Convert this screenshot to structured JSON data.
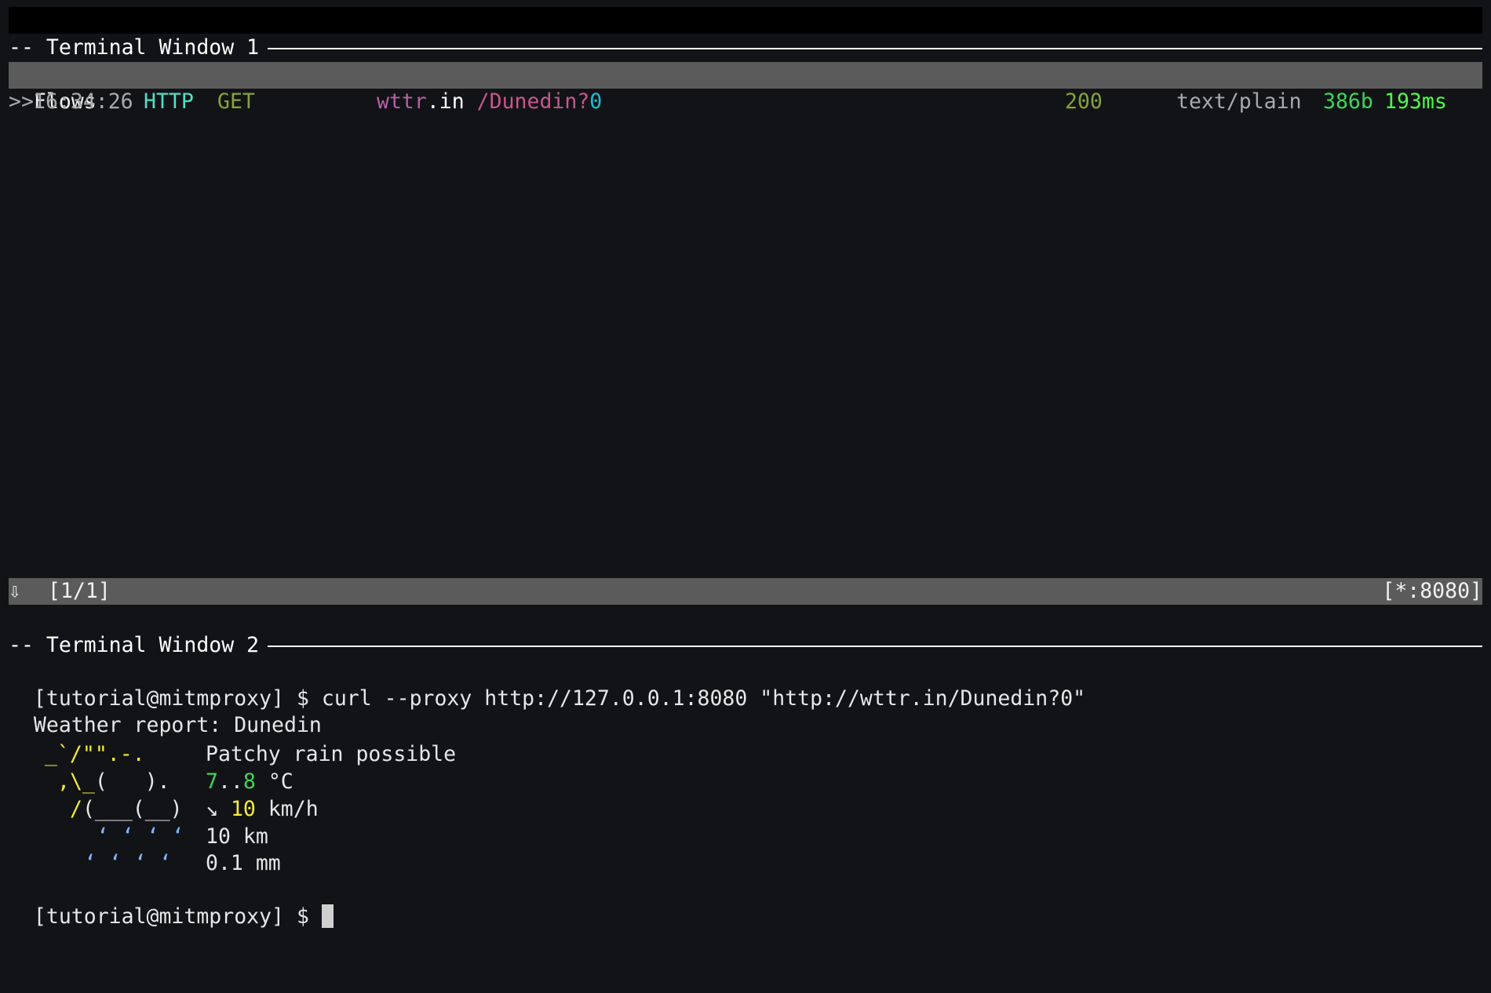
{
  "terminal1": {
    "title": "-- Terminal Window 1",
    "flows_header": "Flows",
    "flow": {
      "marker": ">>",
      "time": "16:34:26",
      "scheme": "HTTP",
      "method": "GET",
      "host_main": "wttr",
      "host_tld": ".in",
      "path": "/Dunedin?",
      "query": "0",
      "status": "200",
      "content_type": "text/plain",
      "size": "386b",
      "duration": "193ms"
    },
    "statusbar": {
      "arrow": "⇩",
      "position": "[1/1]",
      "listen": "[*:8080]"
    }
  },
  "terminal2": {
    "title": "-- Terminal Window 2",
    "prompt": "[tutorial@mitmproxy] $",
    "command": "curl --proxy http://127.0.0.1:8080 \"http://wttr.in/Dunedin?0\"",
    "report_line": "Weather report: Dunedin",
    "art": [
      "_`/\"\".-.",
      ",\\_(   ).",
      "/(___(__)",
      "‘ ‘ ‘ ‘",
      "‘ ‘ ‘ ‘"
    ],
    "weather": {
      "condition": "Patchy rain possible",
      "temp_low": "7",
      "temp_sep": "..",
      "temp_high": "8",
      "temp_unit": "°C",
      "wind_arrow": "↘",
      "wind_speed": "10",
      "wind_unit": "km/h",
      "visibility": "10 km",
      "precip": "0.1 mm"
    },
    "final_prompt": "[tutorial@mitmproxy] $"
  }
}
